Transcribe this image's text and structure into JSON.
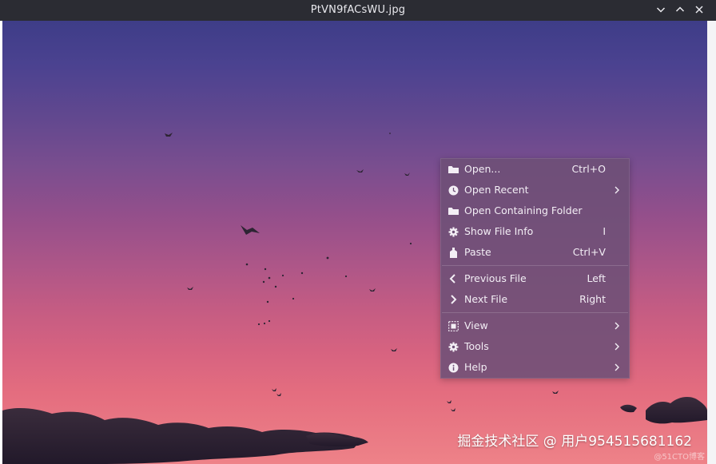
{
  "window": {
    "title": "PtVN9fACsWU.jpg",
    "controls": [
      "minimize",
      "maximize",
      "close"
    ]
  },
  "context_menu": {
    "items": [
      {
        "label": "Open...",
        "shortcut": "Ctrl+O",
        "icon": "folder-icon"
      },
      {
        "label": "Open Recent",
        "shortcut": "",
        "icon": "clock-icon",
        "submenu": true
      },
      {
        "label": "Open Containing Folder",
        "shortcut": "",
        "icon": "folder-icon"
      },
      {
        "label": "Show File Info",
        "shortcut": "I",
        "icon": "gear-icon"
      },
      {
        "label": "Paste",
        "shortcut": "Ctrl+V",
        "icon": "paste-icon"
      },
      {
        "label": "Previous File",
        "shortcut": "Left",
        "icon": "chevron-left-icon"
      },
      {
        "label": "Next File",
        "shortcut": "Right",
        "icon": "chevron-right-icon"
      },
      {
        "label": "View",
        "shortcut": "",
        "icon": "view-icon",
        "submenu": true
      },
      {
        "label": "Tools",
        "shortcut": "",
        "icon": "gear-icon",
        "submenu": true
      },
      {
        "label": "Help",
        "shortcut": "",
        "icon": "info-icon",
        "submenu": true
      }
    ]
  },
  "watermark": {
    "text": "掘金技术社区 @ 用户954515681162",
    "small": "@51CTO博客"
  },
  "colors": {
    "titlebar": "#2b2c33",
    "menu_background": "#6d5076",
    "sky_top": "#3e3d88",
    "sky_bottom": "#ee8288"
  }
}
